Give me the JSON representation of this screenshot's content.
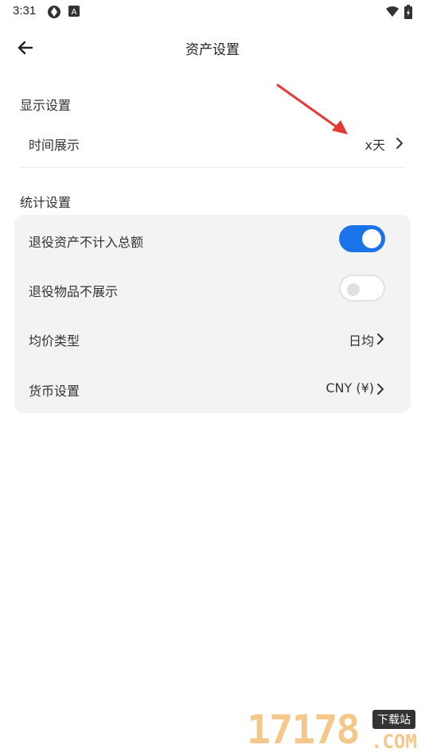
{
  "status_bar": {
    "time": "3:31",
    "icons": [
      "aperture-icon",
      "a-letter-icon",
      "wifi-icon",
      "battery-icon"
    ]
  },
  "header": {
    "title": "资产设置",
    "back_icon": "arrow-left-icon"
  },
  "display_section": {
    "title": "显示设置",
    "items": [
      {
        "label": "时间展示",
        "value": "x天",
        "icon": "chevron-right-icon"
      }
    ]
  },
  "stats_section": {
    "title": "统计设置",
    "items": [
      {
        "label": "退役资产不计入总额",
        "type": "toggle",
        "on": true
      },
      {
        "label": "退役物品不展示",
        "type": "toggle",
        "on": false
      },
      {
        "label": "均价类型",
        "value": "日均",
        "icon": "chevron-right-icon"
      },
      {
        "label": "货币设置",
        "value": "CNY (¥)",
        "icon": "chevron-right-icon"
      }
    ]
  },
  "annotation": {
    "icon": "red-arrow-icon",
    "color": "#e53935"
  },
  "watermark": {
    "number": "17178",
    "badge": "下载站",
    "suffix": ".COM"
  },
  "colors": {
    "accent": "#1a73e8",
    "card_bg": "#f3f3f3"
  }
}
